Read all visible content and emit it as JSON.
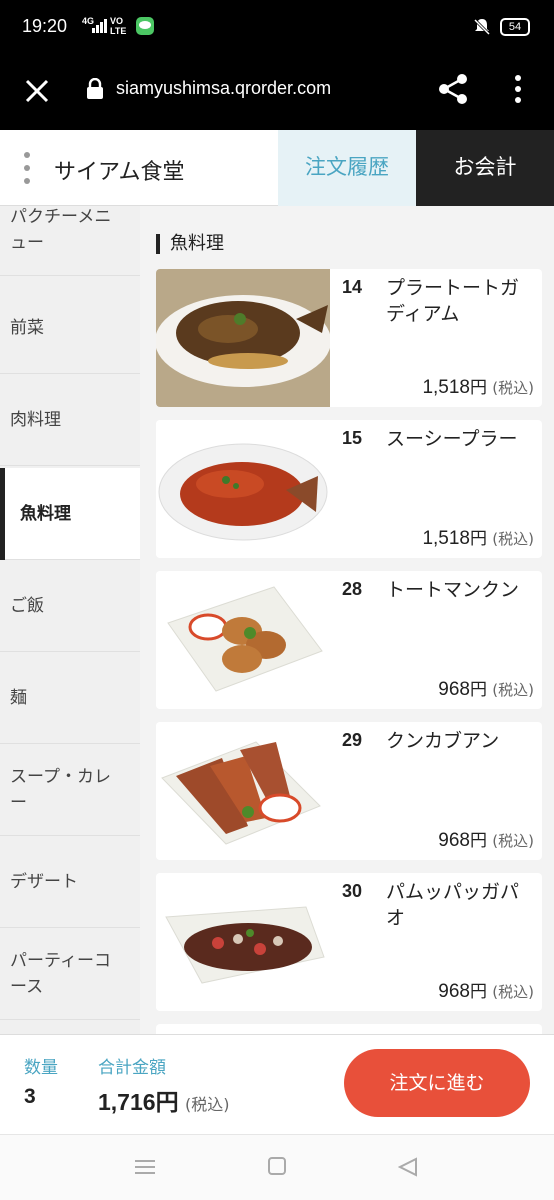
{
  "status": {
    "time": "19:20",
    "network": "4G",
    "volte": "VO\nLTE",
    "battery": "54"
  },
  "browser": {
    "url": "siamyushimsa.qrorder.com"
  },
  "header": {
    "shop_name": "サイアム食堂",
    "history_tab": "注文履歴",
    "checkout_tab": "お会計"
  },
  "sidebar": {
    "items": [
      {
        "label": "パクチーメニュー"
      },
      {
        "label": "前菜"
      },
      {
        "label": "肉料理"
      },
      {
        "label": "魚料理"
      },
      {
        "label": "ご飯"
      },
      {
        "label": "麺"
      },
      {
        "label": "スープ・カレー"
      },
      {
        "label": "デザート"
      },
      {
        "label": "パーティーコース"
      }
    ],
    "active_index": 3
  },
  "main": {
    "section_title": "魚料理",
    "items": [
      {
        "num": "14",
        "name": "プラートートガディアム",
        "price": "1,518",
        "yen": "円",
        "tax": "(税込)"
      },
      {
        "num": "15",
        "name": "スーシープラー",
        "price": "1,518",
        "yen": "円",
        "tax": "(税込)"
      },
      {
        "num": "28",
        "name": "トートマンクン",
        "price": "968",
        "yen": "円",
        "tax": "(税込)"
      },
      {
        "num": "29",
        "name": "クンカブアン",
        "price": "968",
        "yen": "円",
        "tax": "(税込)"
      },
      {
        "num": "30",
        "name": "パムッパッガパオ",
        "price": "968",
        "yen": "円",
        "tax": "(税込)"
      }
    ]
  },
  "footer": {
    "qty_label": "数量",
    "qty_value": "3",
    "total_label": "合計金額",
    "total_value": "1,716",
    "total_yen": "円",
    "total_tax": "(税込)",
    "order_button": "注文に進む"
  },
  "colors": {
    "accent": "#4aa5c2",
    "order_button": "#e8503a",
    "dark": "#222222"
  }
}
